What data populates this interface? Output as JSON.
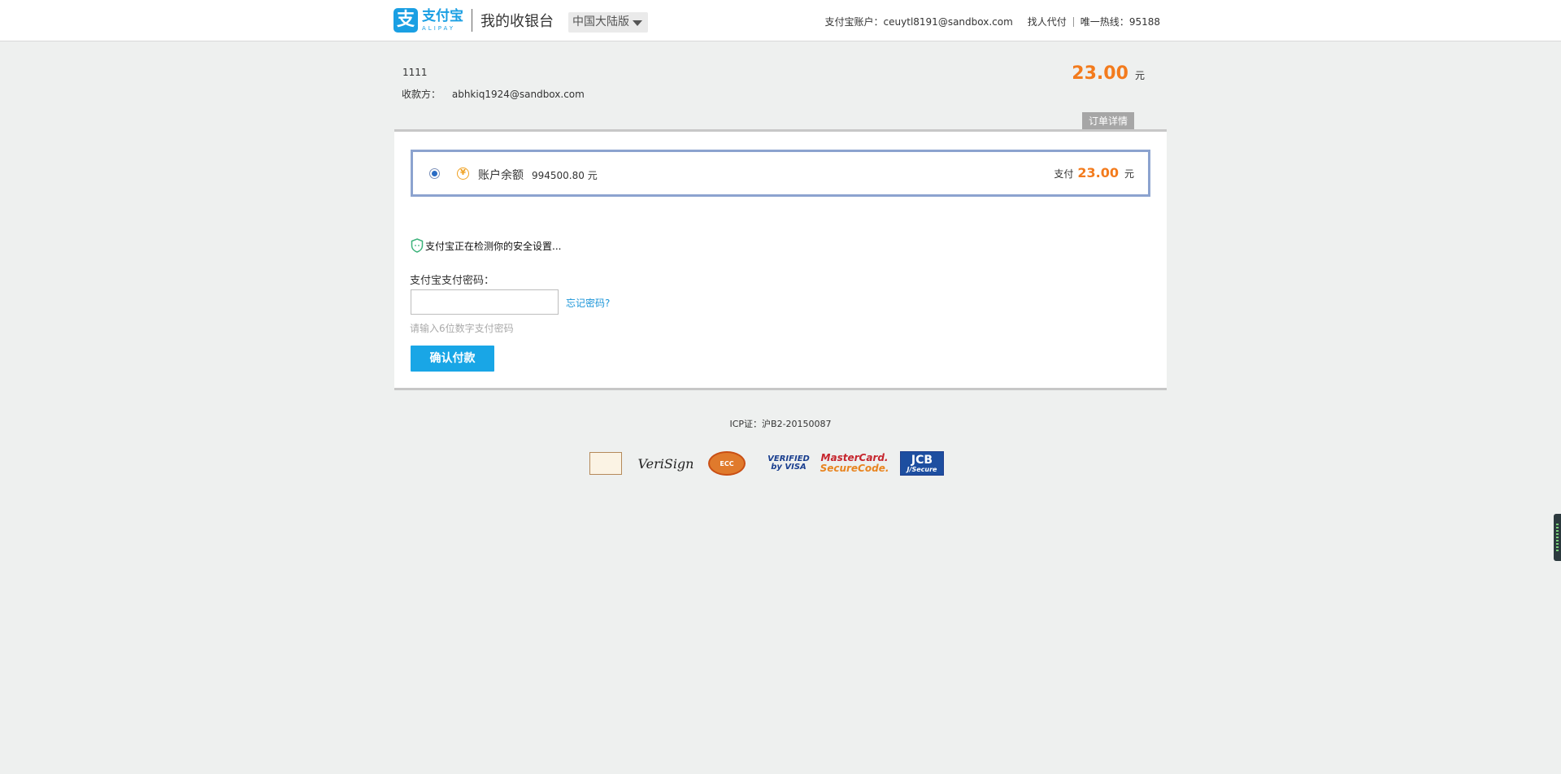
{
  "header": {
    "logo_cn": "支付宝",
    "logo_en": "ALIPAY",
    "title": "我的收银台",
    "region": "中国大陆版",
    "account_label": "支付宝账户：",
    "account_value": "ceuytl8191@sandbox.com",
    "proxy_pay": "找人代付",
    "hotline_label": "唯一热线：",
    "hotline_value": "95188"
  },
  "order": {
    "name": "1111",
    "payee_label": "收款方：",
    "payee_value": "abhkiq1924@sandbox.com",
    "total": "23.00",
    "unit": "元",
    "detail_button": "订单详情"
  },
  "payment": {
    "method_label": "账户余额",
    "balance": "994500.80 元",
    "coin_symbol": "¥",
    "pay_label": "支付",
    "pay_amount": "23.00",
    "pay_unit": "元",
    "selected": true
  },
  "security": {
    "checking_text": "支付宝正在检测你的安全设置..."
  },
  "password": {
    "label": "支付宝支付密码：",
    "value": "",
    "forgot_link": "忘记密码?",
    "hint": "请输入6位数字支付密码",
    "confirm_button": "确认付款"
  },
  "footer": {
    "icp": "ICP证：沪B2-20150087",
    "certs": {
      "verisign": "VeriSign",
      "ecc": "ECC",
      "visa_line1": "VERIFIED",
      "visa_line2": "by VISA",
      "mc_line1": "MasterCard.",
      "mc_line2": "SecureCode.",
      "jcb_line1": "JCB",
      "jcb_line2": "J/Secure"
    }
  },
  "colors": {
    "brand_blue": "#1a9fe3",
    "amount_orange": "#f37b1d",
    "button_blue": "#19a6e6",
    "method_border": "#8ca3cf",
    "link_blue": "#1b95d8"
  }
}
